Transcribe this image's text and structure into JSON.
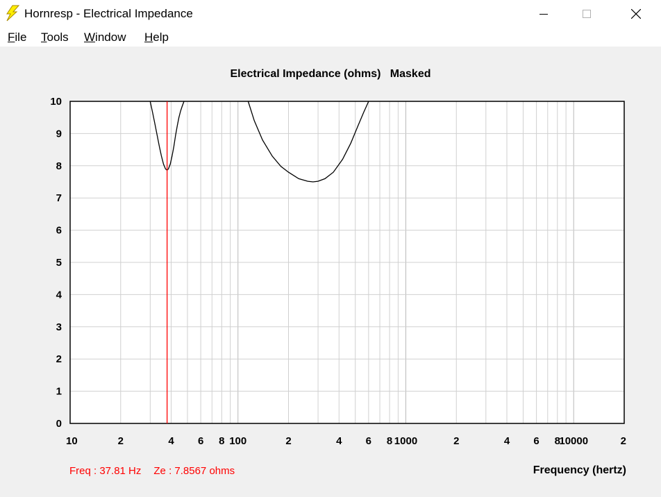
{
  "window": {
    "title": "Hornresp - Electrical Impedance",
    "icon": "lightning-icon",
    "controls": [
      "minimize-icon",
      "maximize-icon",
      "close-icon"
    ]
  },
  "menu": [
    {
      "label": "File"
    },
    {
      "label": "Tools"
    },
    {
      "label": "Window"
    },
    {
      "label": "Help"
    }
  ],
  "readout": {
    "freq": "Freq : 37.81 Hz",
    "ze": "Ze : 7.8567 ohms"
  },
  "colors": {
    "curve": "#000000",
    "marker": "#ff0000",
    "grid_minor": "#d0d0d0",
    "grid_major": "#b8b8b8"
  },
  "chart_data": {
    "type": "line",
    "title": "Electrical Impedance (ohms)   Masked",
    "xlabel": "Frequency (hertz)",
    "ylabel": "",
    "xscale": "log",
    "xlim": [
      10,
      20000
    ],
    "ylim": [
      0,
      10
    ],
    "grid": true,
    "x_tick_labels": [
      "10",
      "2",
      "4",
      "6",
      "8",
      "100",
      "2",
      "4",
      "6",
      "8",
      "1000",
      "2",
      "4",
      "6",
      "8",
      "10000",
      "2"
    ],
    "y_tick_labels": [
      "10",
      "9",
      "8",
      "7",
      "6",
      "5",
      "4",
      "3",
      "2",
      "1",
      "0"
    ],
    "marker": {
      "x": 37.81,
      "y": 7.8567
    },
    "series": [
      {
        "x": [
          30,
          31,
          32,
          33,
          34,
          35,
          36,
          37,
          37.81,
          38.5,
          39.5,
          40.5,
          41.5,
          42.5,
          43.5,
          44.5,
          45.5,
          46.5,
          47.7
        ],
        "y": [
          10,
          9.65,
          9.3,
          8.95,
          8.6,
          8.3,
          8.05,
          7.9,
          7.86,
          7.9,
          8.05,
          8.3,
          8.6,
          8.95,
          9.25,
          9.5,
          9.7,
          9.85,
          10
        ]
      },
      {
        "x": [
          115,
          125,
          140,
          160,
          180,
          200,
          230,
          260,
          280,
          300,
          330,
          370,
          420,
          470,
          520,
          560,
          600
        ],
        "y": [
          10,
          9.4,
          8.8,
          8.3,
          7.98,
          7.8,
          7.6,
          7.52,
          7.5,
          7.52,
          7.6,
          7.8,
          8.2,
          8.7,
          9.25,
          9.65,
          10
        ]
      }
    ]
  }
}
